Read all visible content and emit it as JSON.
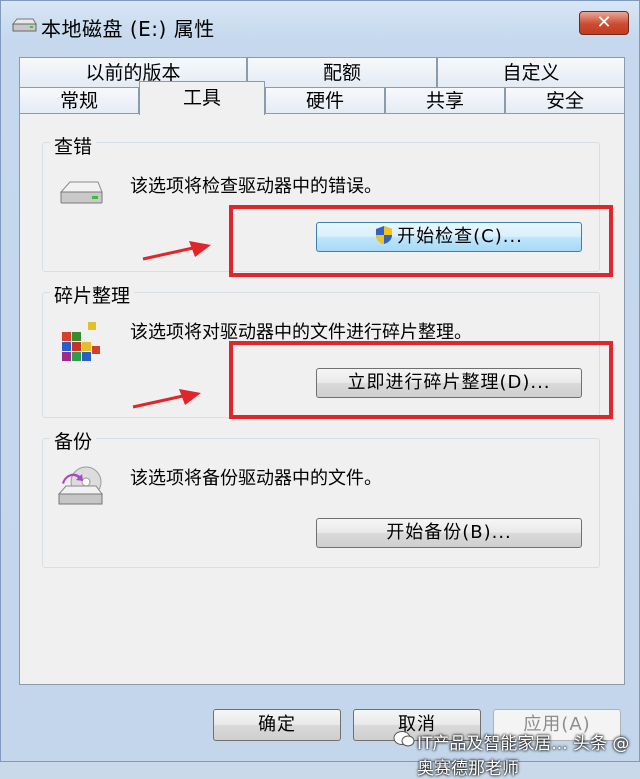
{
  "window": {
    "title": "本地磁盘 (E:) 属性",
    "close_label": "✕"
  },
  "tabs": {
    "row_back": [
      {
        "label": "以前的版本"
      },
      {
        "label": "配额"
      },
      {
        "label": "自定义"
      }
    ],
    "row_front": [
      {
        "label": "常规"
      },
      {
        "label": "工具",
        "active": true
      },
      {
        "label": "硬件"
      },
      {
        "label": "共享"
      },
      {
        "label": "安全"
      }
    ]
  },
  "groups": {
    "error_check": {
      "title": "查错",
      "description": "该选项将检查驱动器中的错误。",
      "button_label": "开始检查(C)..."
    },
    "defrag": {
      "title": "碎片整理",
      "description": "该选项将对驱动器中的文件进行碎片整理。",
      "button_label": "立即进行碎片整理(D)..."
    },
    "backup": {
      "title": "备份",
      "description": "该选项将备份驱动器中的文件。",
      "button_label": "开始备份(B)..."
    }
  },
  "footer": {
    "ok_label": "确定",
    "cancel_label": "取消",
    "apply_label": "应用(A)"
  },
  "watermark": {
    "text": "IT产品及智能家居... 头条 @奥赛德那老师"
  },
  "colors": {
    "annotation_red": "#e0262a",
    "panel_bg": "#f0f0f0",
    "window_frame": "#c5d8ed"
  }
}
